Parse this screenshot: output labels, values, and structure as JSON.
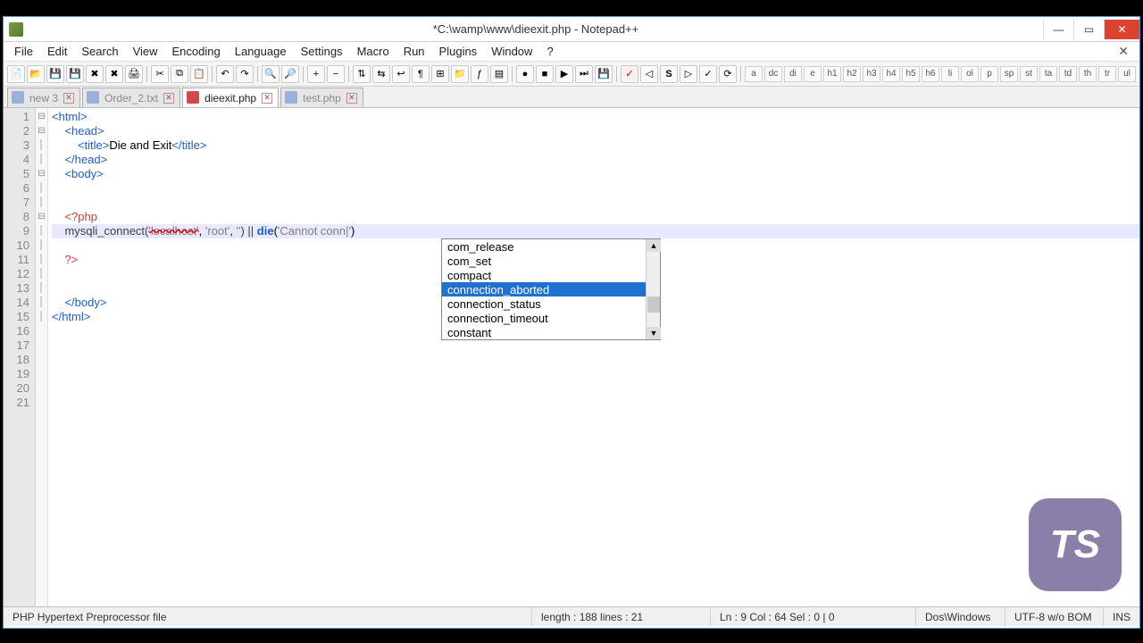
{
  "title": "*C:\\wamp\\www\\dieexit.php - Notepad++",
  "menu": [
    "File",
    "Edit",
    "Search",
    "View",
    "Encoding",
    "Language",
    "Settings",
    "Macro",
    "Run",
    "Plugins",
    "Window",
    "?"
  ],
  "html_tags": [
    "a",
    "dc",
    "di",
    "e",
    "h1",
    "h2",
    "h3",
    "h4",
    "h5",
    "h6",
    "li",
    "ol",
    "p",
    "sp",
    "st",
    "ta",
    "td",
    "th",
    "tr",
    "ul"
  ],
  "tabs": [
    {
      "label": "new  3",
      "active": false,
      "dim": true
    },
    {
      "label": "Order_2.txt",
      "active": false,
      "dim": true
    },
    {
      "label": "dieexit.php",
      "active": true,
      "dim": false
    },
    {
      "label": "test.php",
      "active": false,
      "dim": true
    }
  ],
  "lines": 21,
  "code": {
    "l1": "<html>",
    "l2": "    <head>",
    "l3_a": "        <title>",
    "l3_b": "Die and Exit",
    "l3_c": "</title>",
    "l4": "    </head>",
    "l5": "    <body>",
    "l8": "    <?php",
    "l9_func": "    mysqli_connect(",
    "l9_s1": "'localhost'",
    "l9_c1": ", ",
    "l9_s2": "'root'",
    "l9_c2": ", ",
    "l9_s3": "''",
    "l9_op": ") || ",
    "l9_die": "die",
    "l9_p": "(",
    "l9_s4": "'Cannot conn|'",
    "l9_end": ")",
    "l11": "    ?>",
    "l14": "    </body>",
    "l15": "</html>"
  },
  "autocomplete": [
    "com_release",
    "com_set",
    "compact",
    "connection_aborted",
    "connection_status",
    "connection_timeout",
    "constant"
  ],
  "ac_selected": 3,
  "status": {
    "lang": "PHP Hypertext Preprocessor file",
    "len": "length : 188    lines : 21",
    "pos": "Ln : 9    Col : 64    Sel : 0 | 0",
    "eol": "Dos\\Windows",
    "enc": "UTF-8 w/o BOM",
    "mode": "INS"
  },
  "badge": "TS"
}
